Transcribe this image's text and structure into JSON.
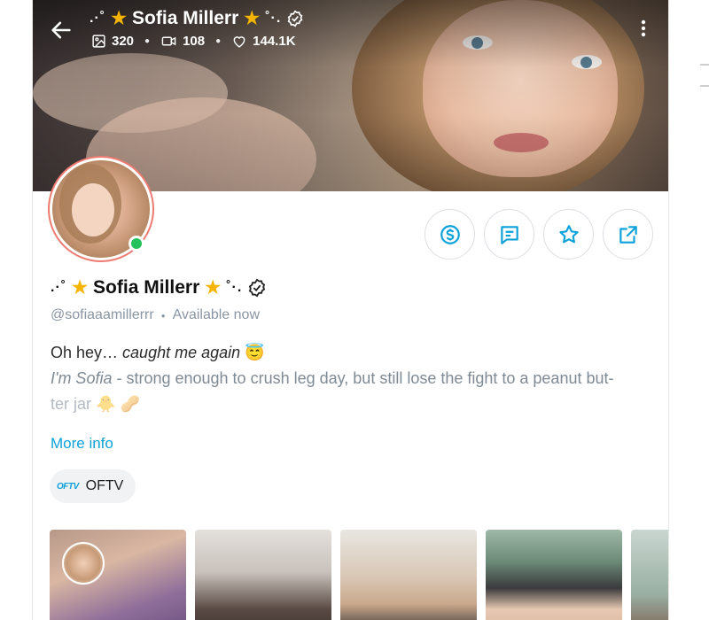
{
  "header": {
    "prefix": ".·˚",
    "name": "Sofia Millerr",
    "suffix": "˚·.",
    "stats": {
      "photos": "320",
      "videos": "108",
      "likes": "144.1K"
    }
  },
  "profile": {
    "prefix": ".·˚",
    "name": "Sofia Millerr",
    "suffix": "˚·.",
    "handle": "@sofiaaamillerrr",
    "status": "Available now",
    "online": true
  },
  "bio": {
    "line1_plain": "Oh hey… ",
    "line1_italic": "caught me again",
    "line1_emoji": "😇",
    "line2_italic": "I'm Sofia",
    "line2_rest": " - strong enough to crush leg day, but still lose the fight to a peanut but-",
    "line3": "ter jar",
    "line3_emoji": "🐥 🥜"
  },
  "links": {
    "more_info": "More info",
    "oftv_logo": "OFTV",
    "oftv_label": "OFTV"
  },
  "actions": [
    {
      "icon": "dollar-icon"
    },
    {
      "icon": "message-icon"
    },
    {
      "icon": "star-icon"
    },
    {
      "icon": "share-icon"
    }
  ],
  "colors": {
    "accent": "#0aa2d8",
    "online": "#25c15b",
    "avatar_ring": "#ee7b72",
    "muted_text": "#8a96a3",
    "star": "#f5b400"
  }
}
